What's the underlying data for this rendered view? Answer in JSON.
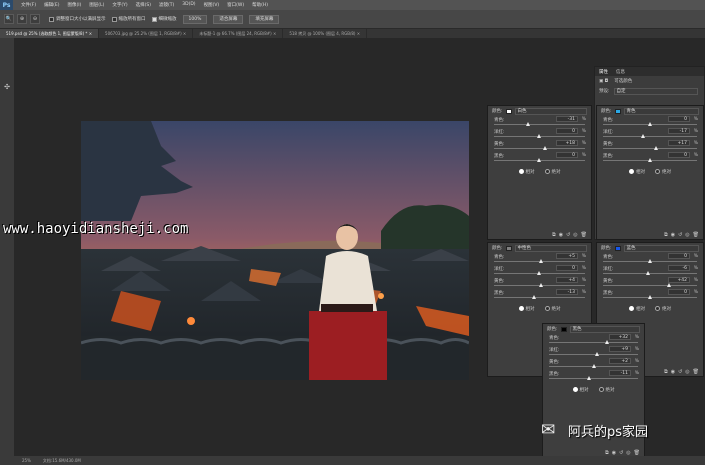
{
  "menubar": {
    "logo": "Ps",
    "items": [
      "文件(F)",
      "编辑(E)",
      "图像(I)",
      "图层(L)",
      "文字(Y)",
      "选择(S)",
      "滤镜(T)",
      "3D(D)",
      "视图(V)",
      "窗口(W)",
      "帮助(H)"
    ]
  },
  "options": {
    "tools": [
      "🔍",
      "⊕",
      "⊖"
    ],
    "checks": [
      {
        "label": "调整窗口大小以满屏显示",
        "checked": false
      },
      {
        "label": "缩放所有窗口",
        "checked": false
      },
      {
        "label": "细微缩放",
        "checked": true
      }
    ],
    "buttons": [
      "100%",
      "适合屏幕",
      "填充屏幕"
    ]
  },
  "tabs": [
    {
      "label": "519.psd @ 25% (选取颜色 1, 图层蒙版/8) * ×",
      "active": true
    },
    {
      "label": "506703.jpg @ 25.2% (图层 1, RGB/8#) ×",
      "active": false
    },
    {
      "label": "未标题-1 @ 66.7% (图层 24, RGB/8#) ×",
      "active": false
    },
    {
      "label": "518 拷贝 @ 100% (图层 4, RGB/8) ×",
      "active": false
    }
  ],
  "status": {
    "zoom": "25%",
    "doc": "文档:15.6M/430.0M"
  },
  "watermark": "www.haoyidiansheji.com",
  "brand": {
    "text": "阿兵的ps家园"
  },
  "properties": {
    "tabs": [
      "属性",
      "信息"
    ],
    "title": "可选颜色",
    "preset_label": "预设:",
    "preset_value": "自定"
  },
  "panels": [
    {
      "id": "white",
      "color_label": "颜色:",
      "color_name": "白色",
      "swatch": "#ffffff",
      "sliders": [
        {
          "label": "青色:",
          "value": "-31",
          "pos": 0.38
        },
        {
          "label": "洋红:",
          "value": "0",
          "pos": 0.5
        },
        {
          "label": "黄色:",
          "value": "+18",
          "pos": 0.57
        },
        {
          "label": "黑色:",
          "value": "0",
          "pos": 0.5
        }
      ],
      "radio_a": "相对",
      "radio_b": "绝对"
    },
    {
      "id": "cyan",
      "color_label": "颜色:",
      "color_name": "青色",
      "swatch": "#2aa8e6",
      "sliders": [
        {
          "label": "青色:",
          "value": "0",
          "pos": 0.5
        },
        {
          "label": "洋红:",
          "value": "-17",
          "pos": 0.43
        },
        {
          "label": "黄色:",
          "value": "+17",
          "pos": 0.57
        },
        {
          "label": "黑色:",
          "value": "0",
          "pos": 0.5
        }
      ],
      "radio_a": "相对",
      "radio_b": "绝对"
    },
    {
      "id": "neutral",
      "color_label": "颜色:",
      "color_name": "中性色",
      "swatch": "#808080",
      "sliders": [
        {
          "label": "青色:",
          "value": "+5",
          "pos": 0.52
        },
        {
          "label": "洋红:",
          "value": "0",
          "pos": 0.5
        },
        {
          "label": "黄色:",
          "value": "+4",
          "pos": 0.52
        },
        {
          "label": "黑色:",
          "value": "-13",
          "pos": 0.45
        }
      ],
      "radio_a": "相对",
      "radio_b": "绝对"
    },
    {
      "id": "blue",
      "color_label": "颜色:",
      "color_name": "蓝色",
      "swatch": "#1656e8",
      "sliders": [
        {
          "label": "青色:",
          "value": "0",
          "pos": 0.5
        },
        {
          "label": "洋红:",
          "value": "-6",
          "pos": 0.48
        },
        {
          "label": "黄色:",
          "value": "+42",
          "pos": 0.71
        },
        {
          "label": "黑色:",
          "value": "0",
          "pos": 0.5
        }
      ],
      "radio_a": "相对",
      "radio_b": "绝对"
    },
    {
      "id": "black",
      "color_label": "颜色:",
      "color_name": "黑色",
      "swatch": "#000000",
      "sliders": [
        {
          "label": "青色:",
          "value": "+32",
          "pos": 0.66
        },
        {
          "label": "洋红:",
          "value": "+9",
          "pos": 0.55
        },
        {
          "label": "黄色:",
          "value": "+2",
          "pos": 0.51
        },
        {
          "label": "黑色:",
          "value": "-11",
          "pos": 0.45
        }
      ],
      "radio_a": "相对",
      "radio_b": "绝对"
    }
  ]
}
